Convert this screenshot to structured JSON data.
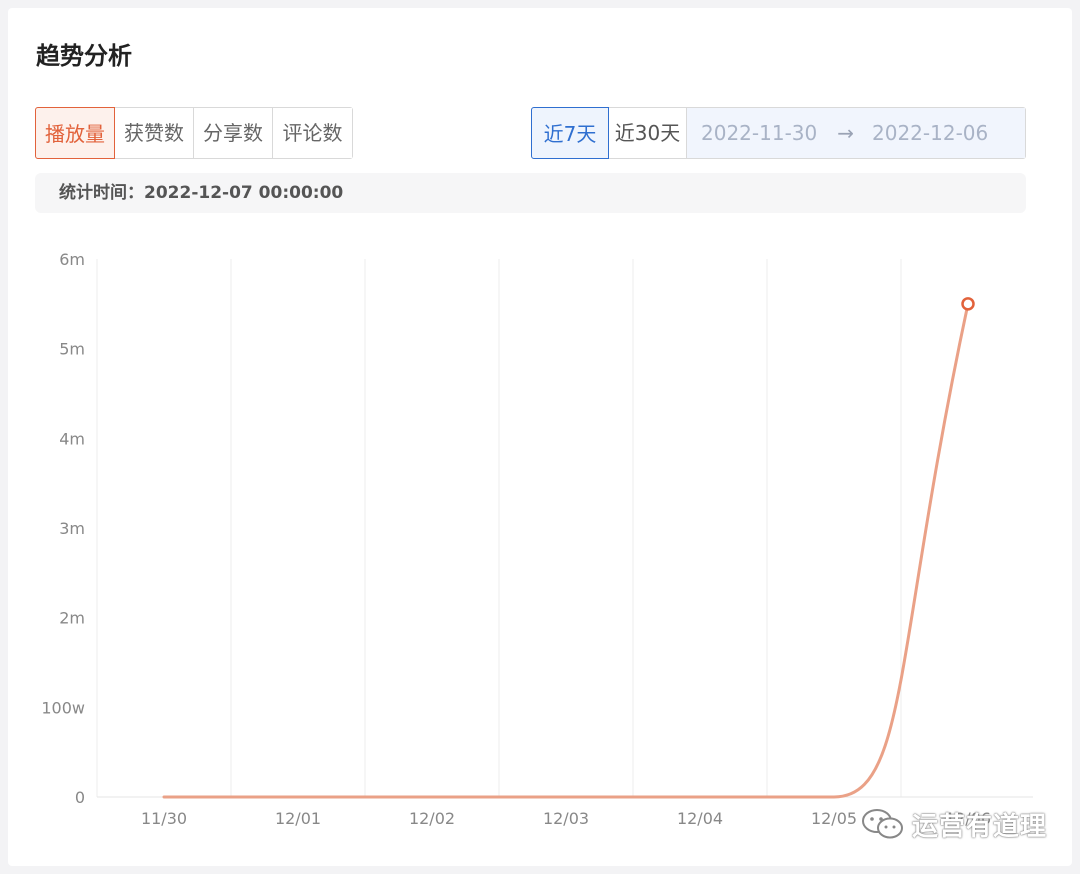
{
  "title": "趋势分析",
  "metric_tabs": [
    {
      "label": "播放量",
      "active": true
    },
    {
      "label": "获赞数",
      "active": false
    },
    {
      "label": "分享数",
      "active": false
    },
    {
      "label": "评论数",
      "active": false
    }
  ],
  "range_buttons": [
    {
      "label": "近7天",
      "active": true
    },
    {
      "label": "近30天",
      "active": false
    }
  ],
  "date_range": {
    "start": "2022-11-30",
    "arrow": "→",
    "end": "2022-12-06"
  },
  "stat": {
    "label": "统计时间：",
    "value": "2022-12-07 00:00:00"
  },
  "watermark": "运营有道理",
  "colors": {
    "accent": "#e2623b",
    "line": "#eaa187",
    "selected_blue": "#2f6fd0"
  },
  "chart_data": {
    "type": "line",
    "categories": [
      "11/30",
      "12/01",
      "12/02",
      "12/03",
      "12/04",
      "12/05",
      "12/06"
    ],
    "y_tick_labels": [
      "0",
      "100w",
      "2m",
      "3m",
      "4m",
      "5m",
      "6m"
    ],
    "y_tick_values": [
      0,
      1000000,
      2000000,
      3000000,
      4000000,
      5000000,
      6000000
    ],
    "ylim": [
      0,
      6000000
    ],
    "series": [
      {
        "values": [
          0,
          0,
          0,
          0,
          0,
          0,
          5500000
        ]
      }
    ],
    "grid": "vertical",
    "title": "",
    "xlabel": "",
    "ylabel": ""
  }
}
